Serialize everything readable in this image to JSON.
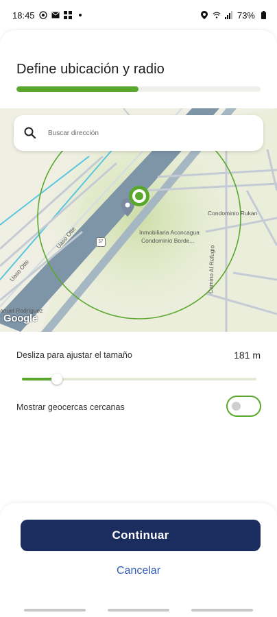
{
  "status_bar": {
    "time": "18:45",
    "left_icons": [
      "whatsapp-icon",
      "mail-icon",
      "grid-icon",
      "dot-icon"
    ],
    "right_icons": [
      "location-icon",
      "wifi-icon",
      "signal-icon"
    ],
    "battery": "73%"
  },
  "screen": {
    "title": "Define ubicación y radio",
    "progress_fraction": 0.5
  },
  "search": {
    "placeholder": "Buscar dirección",
    "icon": "search-icon"
  },
  "map": {
    "labels": {
      "street_1": "Condominio Rukan",
      "street_2": "Inmobiliaria Aconcagua",
      "street_3": "Condominio Borde...",
      "street_4": "Camino Al Refugio",
      "street_5": "Uaso Otte",
      "street_6": "Uaso Otte",
      "street_7": "anuel Rodríguez",
      "route_badge": "57"
    },
    "logo": "Google",
    "radius_circle_color": "#5aa72e"
  },
  "radius": {
    "label": "Desliza para ajustar el tamaño",
    "value": "181 m",
    "slider_fraction": 0.15
  },
  "geofence": {
    "label": "Mostrar geocercas cercanas",
    "enabled": false
  },
  "actions": {
    "continue": "Continuar",
    "cancel": "Cancelar"
  },
  "colors": {
    "accent": "#5aa72e",
    "primary_button": "#1b2d5e",
    "link": "#2f5bb4"
  }
}
